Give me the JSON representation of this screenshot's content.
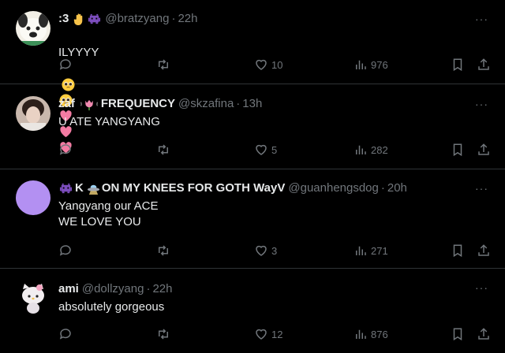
{
  "tweets": [
    {
      "display_name": ":3",
      "handle": "@bratzyang",
      "time": "22h",
      "text": "ILYYYY",
      "likes": "10",
      "views": "976",
      "avatar": "animal-crossing-dog-avatar",
      "emoji_after_text": [
        "pleading-face",
        "pleading-face",
        "pink-heart",
        "pink-heart",
        "pink-heart"
      ]
    },
    {
      "display_name": "zaf",
      "display_name_suffix": "FREQUENCY",
      "handle": "@skzafina",
      "time": "13h",
      "text": "U ATE YANGYANG",
      "likes": "5",
      "views": "282",
      "avatar": "selfie-photo-avatar"
    },
    {
      "display_name": "K",
      "display_name_suffix": "ON MY KNEES FOR GOTH WayV",
      "handle": "@guanhengsdog",
      "time": "20h",
      "text": "Yangyang our ACE\nWE LOVE YOU",
      "likes": "3",
      "views": "271",
      "avatar": "purple-circle-avatar"
    },
    {
      "display_name": "ami",
      "handle": "@dollzyang",
      "time": "22h",
      "text": "absolutely gorgeous",
      "likes": "12",
      "views": "876",
      "avatar": "hello-kitty-avatar"
    }
  ],
  "colors": {
    "background": "#000000",
    "text": "#e7e9ea",
    "muted": "#71767b",
    "divider": "#2f3336",
    "purple_avatar": "#b390f2"
  }
}
